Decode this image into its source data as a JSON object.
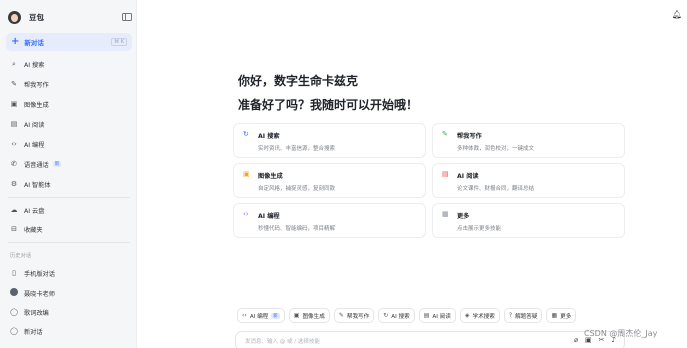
{
  "sidebar": {
    "brand": "豆包",
    "new_chat": {
      "label": "新对话",
      "shortcut": "⌘ K"
    },
    "nav": [
      {
        "label": "AI 搜索",
        "icon": "search-icon"
      },
      {
        "label": "帮我写作",
        "icon": "pen-icon"
      },
      {
        "label": "图像生成",
        "icon": "image-icon"
      },
      {
        "label": "AI 阅读",
        "icon": "book-icon"
      },
      {
        "label": "AI 编程",
        "icon": "code-icon"
      },
      {
        "label": "语音通话",
        "icon": "phone-icon",
        "badge": "新"
      },
      {
        "label": "AI 智能体",
        "icon": "agent-icon"
      }
    ],
    "nav2": [
      {
        "label": "AI 云盘",
        "icon": "cloud-icon"
      },
      {
        "label": "收藏夹",
        "icon": "bookmark-icon"
      }
    ],
    "history_title": "历史对话",
    "history": [
      {
        "label": "手机版对话",
        "icon": "phone-device-icon"
      },
      {
        "label": "聂晓卡老师",
        "icon": "avatar"
      },
      {
        "label": "歌词改编",
        "icon": "chat-bubble-icon"
      },
      {
        "label": "新对话",
        "icon": "chat-bubble-icon"
      }
    ]
  },
  "main": {
    "greeting_line1": "你好，数字生命卡兹克",
    "greeting_line2": "准备好了吗？我随时可以开始哦！",
    "cards": [
      {
        "title": "AI 搜索",
        "desc": "实时资讯、丰富信源，整合搜索",
        "icon": "search-icon",
        "color": "#2f6bff"
      },
      {
        "title": "帮我写作",
        "desc": "多种体裁，润色校对，一键成文",
        "icon": "pen-icon",
        "color": "#37b24d"
      },
      {
        "title": "图像生成",
        "desc": "自定风格，捕捉灵感，复刻同款",
        "icon": "image-icon",
        "color": "#f5a623"
      },
      {
        "title": "AI 阅读",
        "desc": "论文课件、财报合同，翻译总结",
        "icon": "book-icon",
        "color": "#f04d3a"
      },
      {
        "title": "AI 编程",
        "desc": "秒懂代码、智能编码，项目精解",
        "icon": "code-icon",
        "color": "#9b5de5"
      },
      {
        "title": "更多",
        "desc": "点击展示更多技能",
        "icon": "grid-icon",
        "color": "#8a8f98"
      }
    ],
    "chips": [
      {
        "label": "AI 编程",
        "icon": "code-icon",
        "badge": "新"
      },
      {
        "label": "图像生成",
        "icon": "image-icon"
      },
      {
        "label": "帮我写作",
        "icon": "pen-icon"
      },
      {
        "label": "AI 搜索",
        "icon": "search-icon"
      },
      {
        "label": "AI 阅读",
        "icon": "book-icon"
      },
      {
        "label": "学术搜索",
        "icon": "academic-icon"
      },
      {
        "label": "解题答疑",
        "icon": "question-icon"
      },
      {
        "label": "更多",
        "icon": "grid-icon"
      }
    ],
    "input_placeholder": "发消息、输入 @ 或 / 选择技能"
  },
  "watermark": "CSDN @周杰伦_Jay"
}
